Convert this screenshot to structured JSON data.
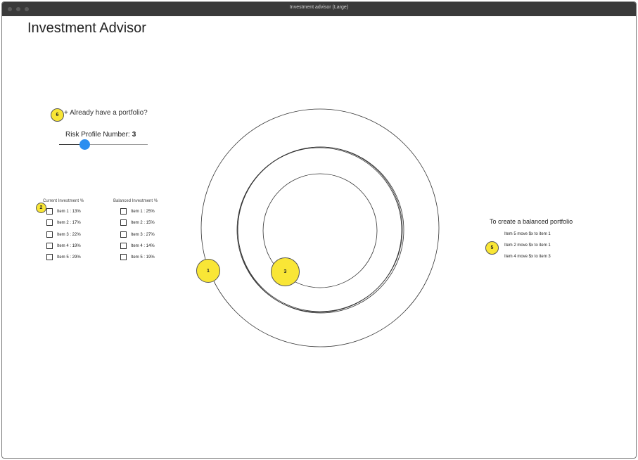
{
  "window": {
    "title": "Investment advisor (Large)"
  },
  "app": {
    "title": "Investment Advisor"
  },
  "portfolio_prompt": {
    "marker": "6",
    "label": "+ Already have a portfolio?"
  },
  "risk_profile": {
    "label": "Risk Profile Number:",
    "value": "3",
    "slider_level_fraction": 0.29
  },
  "investments": {
    "marker": "2",
    "current_header": "Current Investment %",
    "balanced_header": "Balanced Investment %",
    "current": [
      "Item 1 : 13%",
      "Item 2 : 17%",
      "Item 3 : 22%",
      "Item 4 : 19%",
      "Item 5 : 29%"
    ],
    "balanced": [
      "Item 1 : 25%",
      "Item 2 : 15%",
      "Item 3 : 27%",
      "Item 4 : 14%",
      "Item 5 : 19%"
    ]
  },
  "chart_markers": {
    "outer": "1",
    "inner": "3"
  },
  "recommendations": {
    "marker": "5",
    "title": "To create a balanced portfolio",
    "items": [
      "Item 5 move $x to item 1",
      "Item 2 move $x to item 1",
      "Item 4 move $x to item 3"
    ]
  },
  "colors": {
    "slider_thumb": "#2a8ef0",
    "marker_fill": "#f9e636",
    "titlebar": "#3a3a3a"
  }
}
